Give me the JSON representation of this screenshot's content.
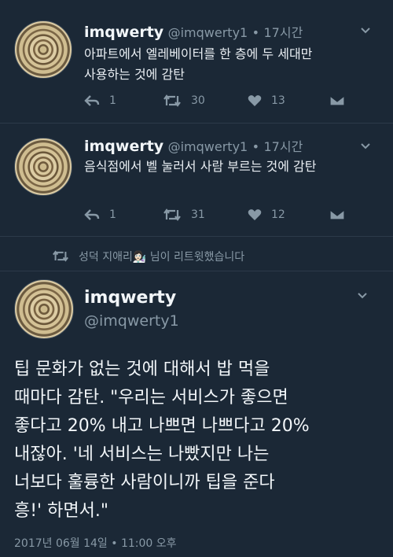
{
  "tweets": [
    {
      "name": "imqwerty",
      "handle": "@imqwerty1",
      "dot": "•",
      "time": "17시간",
      "text_lines": [
        "아파트에서 엘레베이터를 한 층에 두 세대만",
        "사용하는 것에 감탄"
      ],
      "reply_count": "1",
      "retweet_count": "30",
      "like_count": "13"
    },
    {
      "name": "imqwerty",
      "handle": "@imqwerty1",
      "dot": "•",
      "time": "17시간",
      "text_lines": [
        "음식점에서 벨 눌러서 사람 부르는 것에 감탄"
      ],
      "reply_count": "1",
      "retweet_count": "31",
      "like_count": "12"
    }
  ],
  "retweet_notice": "성덕 지애리👩🏻‍🔬 님이 리트윗했습니다",
  "main_tweet": {
    "name": "imqwerty",
    "handle": "@imqwerty1",
    "text_lines": [
      "팁 문화가 없는 것에 대해서 밥 먹을",
      "때마다 감탄. \"우리는 서비스가 좋으면",
      "좋다고 20% 내고 나쁘면 나쁘다고 20%",
      "내잖아. '네 서비스는 나빴지만 나는",
      "너보다 훌륭한 사람이니까 팁을 준다",
      "흥!' 하면서.\""
    ],
    "timestamp": "2017년 06월 14일 • 11:00 오후"
  },
  "icons": {
    "reply": "reply-icon",
    "retweet": "retweet-icon",
    "like": "heart-icon",
    "dm": "dm-icon",
    "caret": "chevron-down-icon"
  }
}
